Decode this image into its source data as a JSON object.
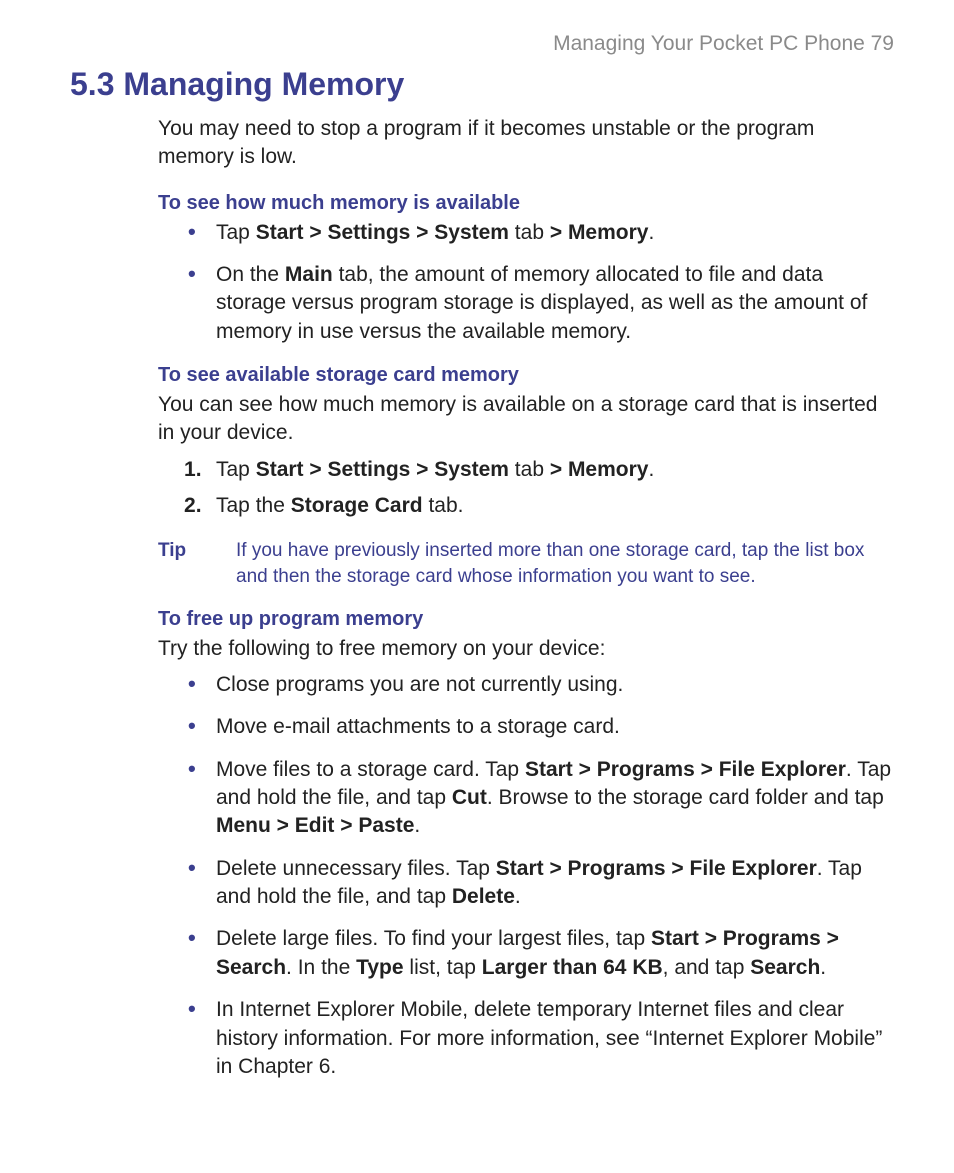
{
  "header": {
    "running": "Managing Your Pocket PC Phone  79"
  },
  "title": "5.3 Managing Memory",
  "intro": "You may need to stop a program if it becomes unstable or the program memory is low.",
  "sec1": {
    "heading": "To see how much memory is available",
    "b1_pre": "Tap ",
    "b1_bold1": "Start > Settings > System",
    "b1_mid": " tab ",
    "b1_bold2": "> Memory",
    "b1_post": ".",
    "b2_pre": "On the ",
    "b2_bold": "Main",
    "b2_post": " tab, the amount of memory allocated to file and data storage versus program storage is displayed, as well as the amount of memory in use versus the available memory."
  },
  "sec2": {
    "heading": "To see available storage card memory",
    "para": "You can see how much memory is available on a storage card that is inserted in your device.",
    "s1_pre": "Tap ",
    "s1_bold1": "Start > Settings > System",
    "s1_mid": " tab ",
    "s1_bold2": "> Memory",
    "s1_post": ".",
    "s2_pre": "Tap the ",
    "s2_bold": "Storage Card",
    "s2_post": " tab."
  },
  "tip": {
    "label": "Tip",
    "text": "If you have previously inserted more than one storage card, tap the list box and then the storage card whose information you want to see."
  },
  "sec3": {
    "heading": "To free up program memory",
    "para": "Try the following to free memory on your device:",
    "i1": "Close programs you are not currently using.",
    "i2": "Move e-mail attachments to a storage card.",
    "i3_a": "Move files to a storage card. Tap ",
    "i3_b": "Start > Programs > File Explorer",
    "i3_c": ". Tap and hold the file, and tap ",
    "i3_d": "Cut",
    "i3_e": ". Browse to the storage card folder and tap ",
    "i3_f": "Menu > Edit > Paste",
    "i3_g": ".",
    "i4_a": "Delete unnecessary files. Tap ",
    "i4_b": "Start > Programs > File Explorer",
    "i4_c": ". Tap and hold the file, and tap ",
    "i4_d": "Delete",
    "i4_e": ".",
    "i5_a": "Delete large files. To find your largest files, tap ",
    "i5_b": "Start > Programs > Search",
    "i5_c": ". In the ",
    "i5_d": "Type",
    "i5_e": " list, tap ",
    "i5_f": "Larger than 64 KB",
    "i5_g": ", and tap ",
    "i5_h": "Search",
    "i5_i": ".",
    "i6": "In Internet Explorer Mobile, delete temporary Internet files and clear history information. For more information, see “Internet Explorer Mobile” in Chapter 6."
  }
}
